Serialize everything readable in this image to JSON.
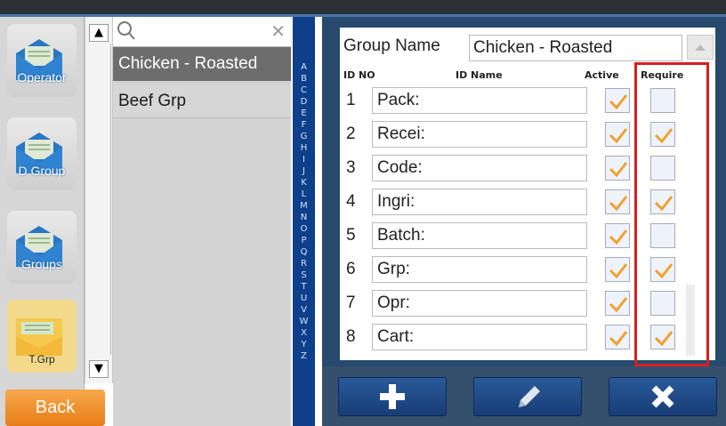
{
  "nav": {
    "items": [
      {
        "label": "Operator",
        "icon": "envelope-icon",
        "active": false
      },
      {
        "label": "D Group",
        "icon": "envelope-icon",
        "active": false
      },
      {
        "label": "Groups",
        "icon": "envelope-icon",
        "active": false
      },
      {
        "label": "T.Grp",
        "icon": "envelope-open-icon",
        "active": true
      }
    ],
    "back_label": "Back"
  },
  "list": {
    "search_placeholder": "",
    "items": [
      {
        "label": "Chicken - Roasted",
        "selected": true
      },
      {
        "label": "Beef Grp",
        "selected": false
      }
    ]
  },
  "alphabet": [
    "A",
    "B",
    "C",
    "D",
    "E",
    "F",
    "G",
    "H",
    "I",
    "J",
    "K",
    "L",
    "M",
    "N",
    "O",
    "P",
    "Q",
    "R",
    "S",
    "T",
    "U",
    "V",
    "W",
    "X",
    "Y",
    "Z"
  ],
  "form": {
    "group_name_label": "Group Name",
    "group_name_value": "Chicken - Roasted",
    "headers": {
      "id_no": "ID NO",
      "id_name": "ID Name",
      "active": "Active",
      "require": "Require"
    },
    "rows": [
      {
        "num": "1",
        "name": "Pack:",
        "active": true,
        "require": false
      },
      {
        "num": "2",
        "name": "Recei:",
        "active": true,
        "require": true
      },
      {
        "num": "3",
        "name": "Code:",
        "active": true,
        "require": false
      },
      {
        "num": "4",
        "name": "Ingri:",
        "active": true,
        "require": true
      },
      {
        "num": "5",
        "name": "Batch:",
        "active": true,
        "require": false
      },
      {
        "num": "6",
        "name": "Grp:",
        "active": true,
        "require": true
      },
      {
        "num": "7",
        "name": "Opr:",
        "active": true,
        "require": false
      },
      {
        "num": "8",
        "name": "Cart:",
        "active": true,
        "require": true
      }
    ]
  },
  "actions": [
    {
      "name": "add-button",
      "icon": "plus-icon"
    },
    {
      "name": "edit-button",
      "icon": "pencil-icon"
    },
    {
      "name": "delete-button",
      "icon": "close-icon"
    }
  ],
  "colors": {
    "check_orange": "#f0a030",
    "highlight_red": "#d91e1e",
    "back_orange": "#ef8f2a",
    "alpha_blue": "#0e3f8a"
  }
}
